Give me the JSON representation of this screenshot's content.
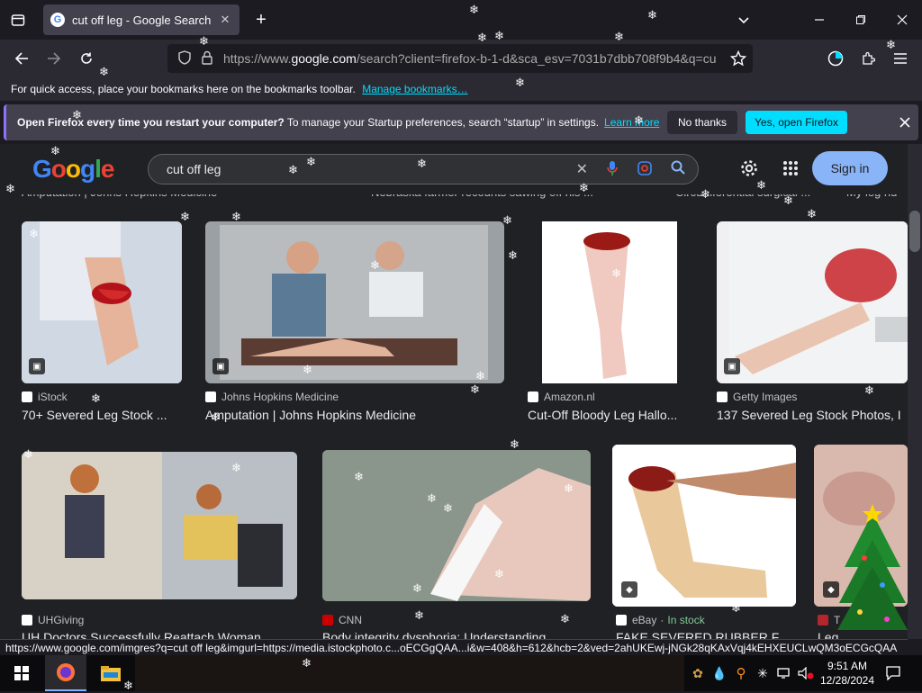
{
  "browser": {
    "tab_title": "cut off leg - Google Search",
    "url_prefix": "https://www.",
    "url_host": "google.com",
    "url_rest": "/search?client=firefox-b-1-d&sca_esv=7031b7dbb708f9b4&q=cu",
    "bookmarks_text": "For quick access, place your bookmarks here on the bookmarks toolbar.",
    "bookmarks_link": "Manage bookmarks…"
  },
  "notification": {
    "bold": "Open Firefox every time you restart your computer?",
    "text": "To manage your Startup preferences, search “startup” in settings.",
    "learn_more": "Learn more",
    "no_thanks": "No thanks",
    "yes_open": "Yes, open Firefox"
  },
  "google": {
    "logo": "Google",
    "query": "cut off leg",
    "sign_in": "Sign in",
    "partial_titles": [
      "Amputation | Johns Hopkins Medicine",
      "Nebraska farmer recounts sawing off his ...",
      "Circumferential surgical ...",
      "My leg hu"
    ]
  },
  "results_row1": [
    {
      "source": "iStock",
      "title": "70+ Severed Leg Stock ..."
    },
    {
      "source": "Johns Hopkins Medicine",
      "title": "Amputation | Johns Hopkins Medicine"
    },
    {
      "source": "Amazon.nl",
      "title": "Cut-Off Bloody Leg Hallo..."
    },
    {
      "source": "Getty Images",
      "title": "137 Severed Leg Stock Photos, I"
    }
  ],
  "results_row2": [
    {
      "source": "UHGiving",
      "title": "UH Doctors Successfully Reattach Woman ..."
    },
    {
      "source": "CNN",
      "title": "Body integrity dysphoria: Understanding ..."
    },
    {
      "source": "eBay",
      "stock": "In stock",
      "title": "FAKE SEVERED RUBBER F..."
    },
    {
      "source": "T",
      "title": "Leg"
    }
  ],
  "status_url": "https://www.google.com/imgres?q=cut off leg&imgurl=https://media.istockphoto.c...oECGgQAA...i&w=408&h=612&hcb=2&ved=2ahUKEwj-jNGk28qKAxVqj4kEHXEUCLwQM3oECGcQAA",
  "taskbar": {
    "time": "9:51 AM",
    "date": "12/28/2024"
  },
  "colors": {
    "accent_cyan": "#00ddff",
    "google_blue": "#8ab4f8"
  }
}
